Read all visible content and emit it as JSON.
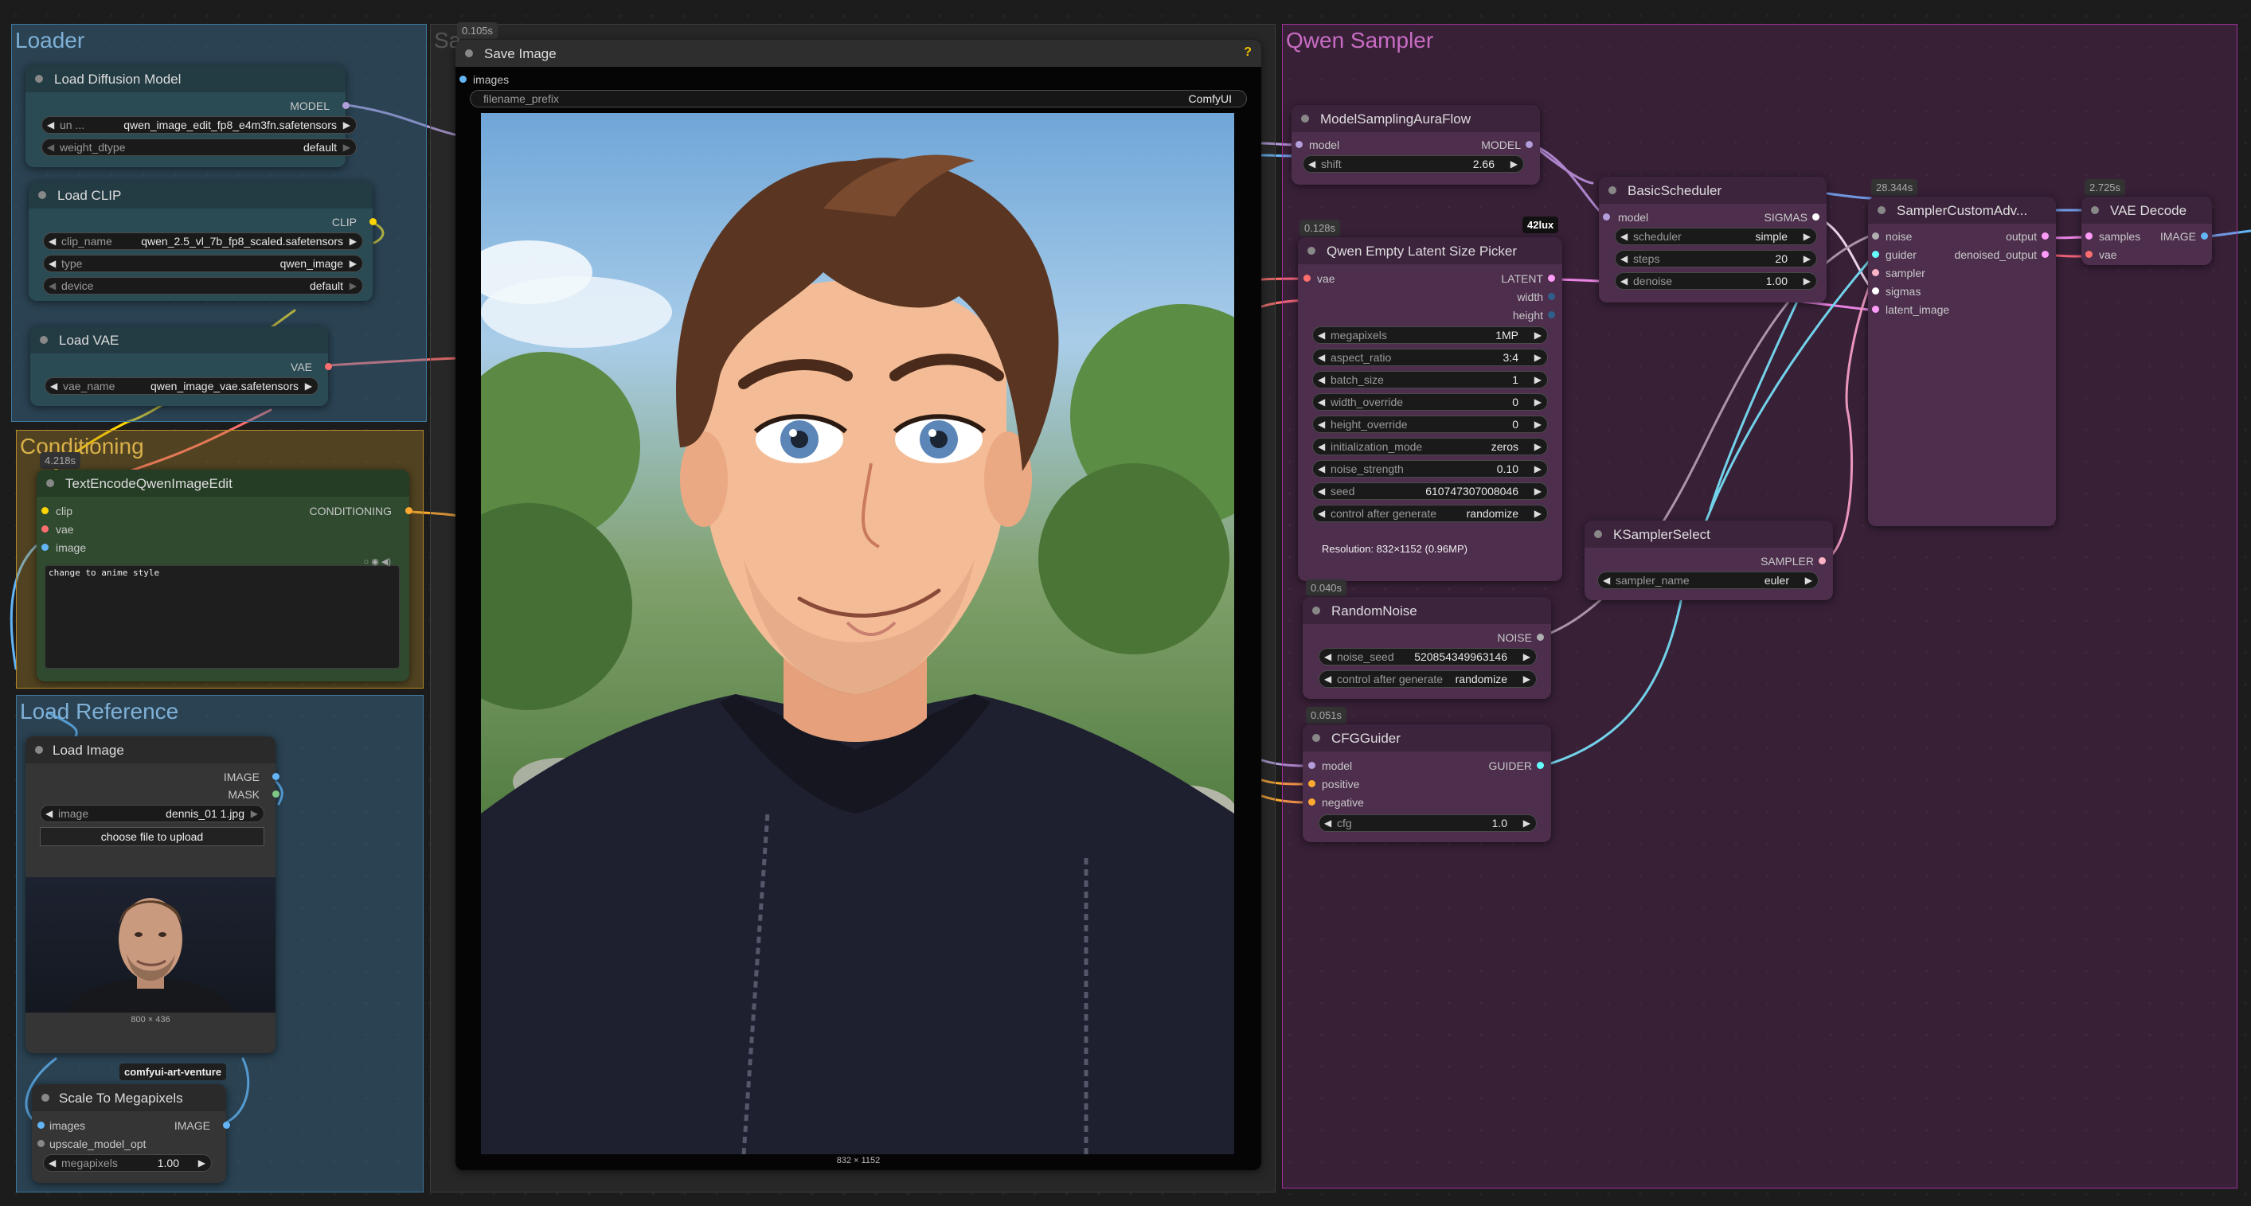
{
  "colors": {
    "model": "#b39ddb",
    "clip": "#ffd500",
    "vae": "#ff6e6e",
    "conditioning": "#ffa931",
    "latent": "#ff9cf9",
    "image": "#64b5f6",
    "sigmas": "#ffffff",
    "guider": "#66ffff",
    "noise": "#b0b0b0",
    "loader_group": "#3f789e",
    "conditioning_group": "#b58b2a",
    "reference_group": "#3f789e",
    "sampler_group": "#a1309b"
  },
  "groups": {
    "loader": "Loader",
    "conditioning": "Conditioning",
    "reference": "Load Reference",
    "sampler": "Qwen Sampler",
    "save_hidden": "Sa"
  },
  "load_diffusion": {
    "title": "Load Diffusion Model",
    "out_model": "MODEL",
    "unet_key": "un ...",
    "unet_value": "qwen_image_edit_fp8_e4m3fn.safetensors",
    "dtype_key": "weight_dtype",
    "dtype_value": "default"
  },
  "load_clip": {
    "title": "Load CLIP",
    "out_clip": "CLIP",
    "clip_name_key": "clip_name",
    "clip_name_value": "qwen_2.5_vl_7b_fp8_scaled.safetensors",
    "type_key": "type",
    "type_value": "qwen_image",
    "device_key": "device",
    "device_value": "default"
  },
  "load_vae": {
    "title": "Load VAE",
    "out_vae": "VAE",
    "vae_name_key": "vae_name",
    "vae_name_value": "qwen_image_vae.safetensors"
  },
  "text_encode": {
    "timing": "4.218s",
    "title": "TextEncodeQwenImageEdit",
    "in_clip": "clip",
    "in_vae": "vae",
    "in_image": "image",
    "out": "CONDITIONING",
    "prompt": "change to anime style"
  },
  "load_image": {
    "title": "Load Image",
    "out_image": "IMAGE",
    "out_mask": "MASK",
    "image_key": "image",
    "image_value": "dennis_01 1.jpg",
    "upload_label": "choose file to upload",
    "dims": "800 × 436"
  },
  "scale": {
    "tag": "comfyui-art-venture",
    "title": "Scale To Megapixels",
    "in_images": "images",
    "in_upscale": "upscale_model_opt",
    "out_image": "IMAGE",
    "mp_key": "megapixels",
    "mp_value": "1.00"
  },
  "save_image": {
    "timing": "0.105s",
    "title": "Save Image",
    "help": "?",
    "in_images": "images",
    "prefix_key": "filename_prefix",
    "prefix_value": "ComfyUI",
    "dims": "832 × 1152"
  },
  "aura": {
    "title": "ModelSamplingAuraFlow",
    "in_model": "model",
    "out_model": "MODEL",
    "shift_key": "shift",
    "shift_value": "2.66"
  },
  "latent_picker": {
    "timing": "0.128s",
    "tag": "42lux",
    "title": "Qwen Empty Latent Size Picker",
    "in_vae": "vae",
    "out_latent": "LATENT",
    "out_width": "width",
    "out_height": "height",
    "widgets": [
      {
        "key": "megapixels",
        "value": "1MP"
      },
      {
        "key": "aspect_ratio",
        "value": "3:4"
      },
      {
        "key": "batch_size",
        "value": "1"
      },
      {
        "key": "width_override",
        "value": "0"
      },
      {
        "key": "height_override",
        "value": "0"
      },
      {
        "key": "initialization_mode",
        "value": "zeros"
      },
      {
        "key": "noise_strength",
        "value": "0.10"
      },
      {
        "key": "seed",
        "value": "610747307008046"
      },
      {
        "key": "control after generate",
        "value": "randomize"
      }
    ],
    "resolution": "Resolution: 832×1152 (0.96MP)"
  },
  "scheduler": {
    "title": "BasicScheduler",
    "in_model": "model",
    "out_sigmas": "SIGMAS",
    "widgets": [
      {
        "key": "scheduler",
        "value": "simple"
      },
      {
        "key": "steps",
        "value": "20"
      },
      {
        "key": "denoise",
        "value": "1.00"
      }
    ]
  },
  "sampler_custom": {
    "timing": "28.344s",
    "title": "SamplerCustomAdv...",
    "inputs": [
      "noise",
      "guider",
      "sampler",
      "sigmas",
      "latent_image"
    ],
    "out_output": "output",
    "out_denoised": "denoised_output"
  },
  "vae_decode": {
    "timing": "2.725s",
    "title": "VAE Decode",
    "in_samples": "samples",
    "in_vae": "vae",
    "out_image": "IMAGE"
  },
  "ksampler_select": {
    "title": "KSamplerSelect",
    "out_sampler": "SAMPLER",
    "name_key": "sampler_name",
    "name_value": "euler"
  },
  "random_noise": {
    "timing": "0.040s",
    "title": "RandomNoise",
    "out_noise": "NOISE",
    "seed_key": "noise_seed",
    "seed_value": "520854349963146",
    "control_key": "control after generate",
    "control_value": "randomize"
  },
  "cfg_guider": {
    "timing": "0.051s",
    "title": "CFGGuider",
    "in_model": "model",
    "in_positive": "positive",
    "in_negative": "negative",
    "out_guider": "GUIDER",
    "cfg_key": "cfg",
    "cfg_value": "1.0"
  }
}
